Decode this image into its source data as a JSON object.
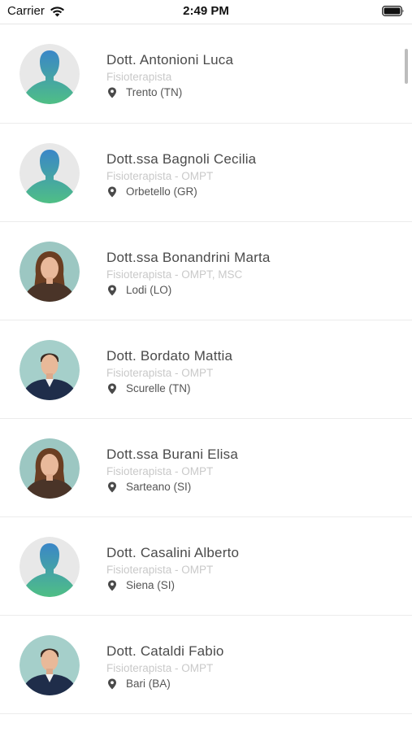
{
  "status_bar": {
    "carrier": "Carrier",
    "time": "2:49 PM"
  },
  "colors": {
    "name_text": "#4a4a4a",
    "role_text": "#c9c9c9",
    "location_text": "#555555",
    "avatar_bg": "#e8e8e8",
    "avatar_gradient_top": "#3a86c8",
    "avatar_gradient_bottom": "#4fbf85"
  },
  "doctors": [
    {
      "name": "Dott. Antonioni Luca",
      "role": "Fisioterapista",
      "location": "Trento (TN)",
      "avatar": "placeholder-silhouette"
    },
    {
      "name": "Dott.ssa Bagnoli Cecilia",
      "role": "Fisioterapista - OMPT",
      "location": "Orbetello (GR)",
      "avatar": "placeholder-silhouette"
    },
    {
      "name": "Dott.ssa Bonandrini Marta",
      "role": "Fisioterapista - OMPT, MSC",
      "location": "Lodi (LO)",
      "avatar": "photo-woman"
    },
    {
      "name": "Dott. Bordato Mattia",
      "role": "Fisioterapista - OMPT",
      "location": "Scurelle (TN)",
      "avatar": "photo-man"
    },
    {
      "name": "Dott.ssa Burani Elisa",
      "role": "Fisioterapista - OMPT",
      "location": "Sarteano (SI)",
      "avatar": "photo-woman"
    },
    {
      "name": "Dott. Casalini Alberto",
      "role": "Fisioterapista - OMPT",
      "location": "Siena (SI)",
      "avatar": "placeholder-silhouette"
    },
    {
      "name": "Dott. Cataldi Fabio",
      "role": "Fisioterapista - OMPT",
      "location": "Bari (BA)",
      "avatar": "photo-man"
    }
  ]
}
